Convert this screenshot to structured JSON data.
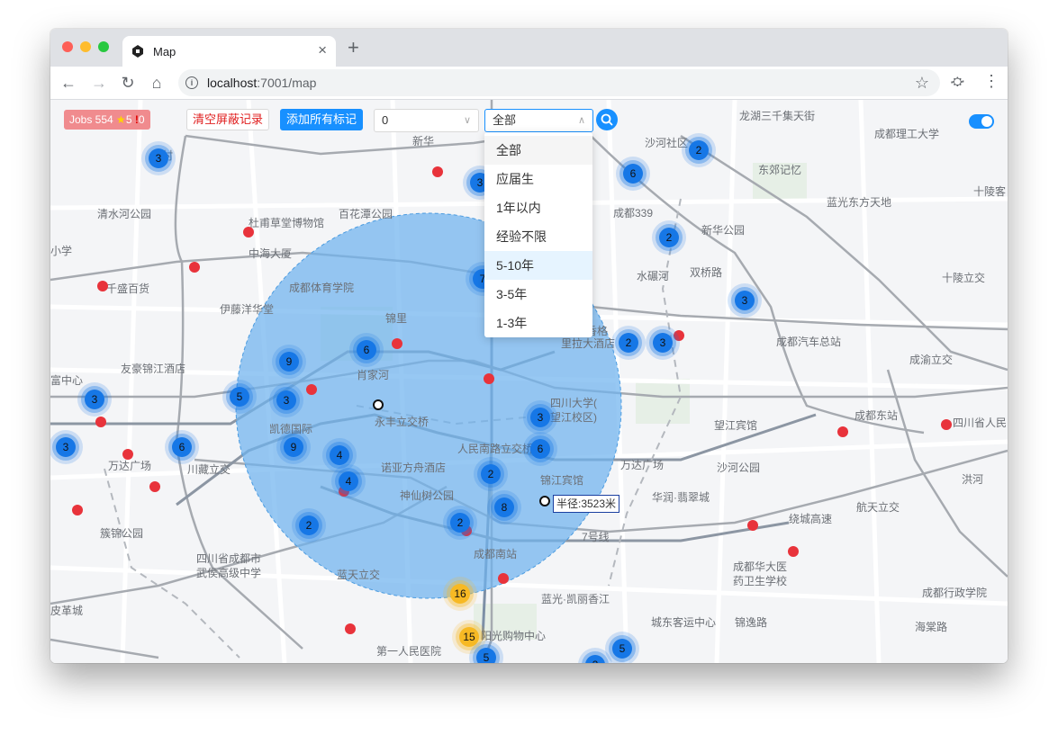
{
  "browser": {
    "tab_title": "Map",
    "tab_close": "×",
    "new_tab": "+",
    "url_host": "localhost",
    "url_path": ":7001/map",
    "icons": [
      "back-icon",
      "forward-icon",
      "reload-icon",
      "home-icon",
      "info-icon",
      "star-icon",
      "extension-icon",
      "menu-icon"
    ]
  },
  "controls": {
    "jobs_label": "Jobs 554",
    "star_count": "5",
    "alert_count": "0",
    "clear_button": "清空屏蔽记录",
    "add_button": "添加所有标记",
    "num_select_value": "0",
    "exp_select_value": "全部",
    "toggle_on": true
  },
  "dropdown": {
    "options": [
      "全部",
      "应届生",
      "1年以内",
      "经验不限",
      "5-10年",
      "3-5年",
      "1-3年"
    ],
    "selected_index": 0,
    "hover_index": 4
  },
  "map": {
    "radius_label": "半径:3523米",
    "colors": {
      "circle": "#7fbdf0",
      "cluster": "#1677e6",
      "cluster_large": "#f7b924",
      "marker": "#e8333b",
      "road": "#9ca0a6"
    },
    "labels": [
      "西村",
      "新华",
      "沙河社区",
      "龙湖三千集天街",
      "成都理工大学",
      "清水河公园",
      "杜甫草堂博物馆",
      "百花潭公园",
      "成都339",
      "东郊记忆",
      "十陵客",
      "蓝光东方天地",
      "新华公园",
      "小学",
      "中海大厦",
      "千盛百货",
      "成都体育学院",
      "水碾河",
      "双桥路",
      "十陵立交",
      "伊藤洋华堂",
      "锦里",
      "芳香格",
      "里拉大酒店",
      "成都汽车总站",
      "友豪锦江酒店",
      "肖家河",
      "四川大学(",
      "望江校区)",
      "成渝立交",
      "富中心",
      "永丰立交桥",
      "望江宾馆",
      "成都东站",
      "四川省人民",
      "凯德国际",
      "人民南路立交桥",
      "洪河",
      "万达广场",
      "川藏立交",
      "锦江宾馆",
      "诺亚方舟酒店",
      "万达广场",
      "沙河公园",
      "神仙树公园",
      "华润·翡翠城",
      "航天立交",
      "簇锦公园",
      "7号线",
      "四川省成都市",
      "武侯高级中学",
      "成都南站",
      "成都华大医",
      "药卫生学校",
      "蓝天立交",
      "成都行政学院",
      "蓝光·凯丽香江",
      "皮革城",
      "城东客运中心",
      "锦逸路",
      "海棠路",
      "绕城高速",
      "第一人民医院",
      "阳光购物中心"
    ],
    "clusters": [
      {
        "count": 3
      },
      {
        "count": 6
      },
      {
        "count": 2
      },
      {
        "count": 7
      },
      {
        "count": 3
      },
      {
        "count": 2
      },
      {
        "count": 6
      },
      {
        "count": 9
      },
      {
        "count": 5
      },
      {
        "count": 3
      },
      {
        "count": 3
      },
      {
        "count": 3
      },
      {
        "count": 6
      },
      {
        "count": 9
      },
      {
        "count": 4
      },
      {
        "count": 4
      },
      {
        "count": 2
      },
      {
        "count": 3
      },
      {
        "count": 6
      },
      {
        "count": 2
      },
      {
        "count": 8
      },
      {
        "count": 16
      },
      {
        "count": 15
      },
      {
        "count": 5
      },
      {
        "count": 2
      },
      {
        "count": 5
      },
      {
        "count": 2
      },
      {
        "count": 3
      },
      {
        "count": 2
      },
      {
        "count": 3
      }
    ]
  }
}
